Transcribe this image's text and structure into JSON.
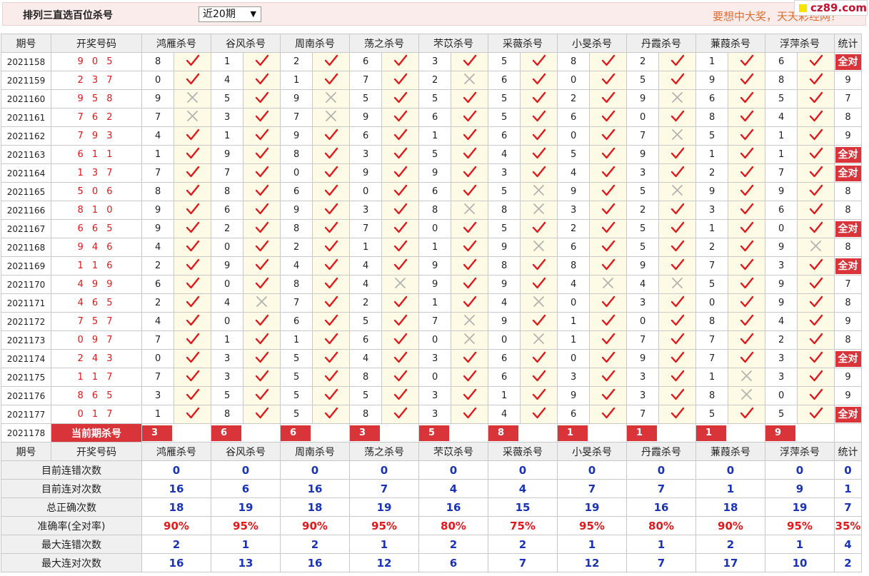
{
  "header": {
    "title": "排列三直选百位杀号",
    "period_select": "近20期",
    "slogan": "要想中大奖，天天彩经网！",
    "logo_text": "cz89.com"
  },
  "table": {
    "columns": {
      "period": "期号",
      "draw": "开奖号码",
      "experts": [
        "鸿雁杀号",
        "谷风杀号",
        "周南杀号",
        "荡之杀号",
        "芣苡杀号",
        "采薇杀号",
        "小旻杀号",
        "丹霞杀号",
        "蒹葭杀号",
        "浮萍杀号"
      ],
      "stat": "统计"
    },
    "rows": [
      {
        "period": "2021158",
        "draw": "9 0 5",
        "kills": [
          "8",
          "1",
          "2",
          "6",
          "3",
          "5",
          "8",
          "2",
          "1",
          "6"
        ],
        "results": [
          1,
          1,
          1,
          1,
          1,
          1,
          1,
          1,
          1,
          1
        ],
        "stat": "全对"
      },
      {
        "period": "2021159",
        "draw": "2 3 7",
        "kills": [
          "0",
          "4",
          "1",
          "7",
          "2",
          "6",
          "0",
          "5",
          "9",
          "8"
        ],
        "results": [
          1,
          1,
          1,
          1,
          0,
          1,
          1,
          1,
          1,
          1
        ],
        "stat": "9"
      },
      {
        "period": "2021160",
        "draw": "9 5 8",
        "kills": [
          "9",
          "5",
          "9",
          "5",
          "5",
          "5",
          "2",
          "9",
          "6",
          "5"
        ],
        "results": [
          0,
          1,
          0,
          1,
          1,
          1,
          1,
          0,
          1,
          1
        ],
        "stat": "7"
      },
      {
        "period": "2021161",
        "draw": "7 6 2",
        "kills": [
          "7",
          "3",
          "7",
          "9",
          "6",
          "5",
          "6",
          "0",
          "8",
          "4"
        ],
        "results": [
          0,
          1,
          0,
          1,
          1,
          1,
          1,
          1,
          1,
          1
        ],
        "stat": "8"
      },
      {
        "period": "2021162",
        "draw": "7 9 3",
        "kills": [
          "4",
          "1",
          "9",
          "6",
          "1",
          "6",
          "0",
          "7",
          "5",
          "1"
        ],
        "results": [
          1,
          1,
          1,
          1,
          1,
          1,
          1,
          0,
          1,
          1
        ],
        "stat": "9"
      },
      {
        "period": "2021163",
        "draw": "6 1 1",
        "kills": [
          "1",
          "9",
          "8",
          "3",
          "5",
          "4",
          "5",
          "9",
          "1",
          "1"
        ],
        "results": [
          1,
          1,
          1,
          1,
          1,
          1,
          1,
          1,
          1,
          1
        ],
        "stat": "全对"
      },
      {
        "period": "2021164",
        "draw": "1 3 7",
        "kills": [
          "7",
          "7",
          "0",
          "9",
          "9",
          "3",
          "4",
          "3",
          "2",
          "7"
        ],
        "results": [
          1,
          1,
          1,
          1,
          1,
          1,
          1,
          1,
          1,
          1
        ],
        "stat": "全对"
      },
      {
        "period": "2021165",
        "draw": "5 0 6",
        "kills": [
          "8",
          "8",
          "6",
          "0",
          "6",
          "5",
          "9",
          "5",
          "9",
          "9"
        ],
        "results": [
          1,
          1,
          1,
          1,
          1,
          0,
          1,
          0,
          1,
          1
        ],
        "stat": "8"
      },
      {
        "period": "2021166",
        "draw": "8 1 0",
        "kills": [
          "9",
          "6",
          "9",
          "3",
          "8",
          "8",
          "3",
          "2",
          "3",
          "6"
        ],
        "results": [
          1,
          1,
          1,
          1,
          0,
          0,
          1,
          1,
          1,
          1
        ],
        "stat": "8"
      },
      {
        "period": "2021167",
        "draw": "6 6 5",
        "kills": [
          "9",
          "2",
          "8",
          "7",
          "0",
          "5",
          "2",
          "5",
          "1",
          "0"
        ],
        "results": [
          1,
          1,
          1,
          1,
          1,
          1,
          1,
          1,
          1,
          1
        ],
        "stat": "全对"
      },
      {
        "period": "2021168",
        "draw": "9 4 6",
        "kills": [
          "4",
          "0",
          "2",
          "1",
          "1",
          "9",
          "6",
          "5",
          "2",
          "9"
        ],
        "results": [
          1,
          1,
          1,
          1,
          1,
          0,
          1,
          1,
          1,
          0
        ],
        "stat": "8"
      },
      {
        "period": "2021169",
        "draw": "1 1 6",
        "kills": [
          "2",
          "9",
          "4",
          "4",
          "9",
          "8",
          "8",
          "9",
          "7",
          "3"
        ],
        "results": [
          1,
          1,
          1,
          1,
          1,
          1,
          1,
          1,
          1,
          1
        ],
        "stat": "全对"
      },
      {
        "period": "2021170",
        "draw": "4 9 9",
        "kills": [
          "6",
          "0",
          "8",
          "4",
          "9",
          "9",
          "4",
          "4",
          "5",
          "9"
        ],
        "results": [
          1,
          1,
          1,
          0,
          1,
          1,
          0,
          0,
          1,
          1
        ],
        "stat": "7"
      },
      {
        "period": "2021171",
        "draw": "4 6 5",
        "kills": [
          "2",
          "4",
          "7",
          "2",
          "1",
          "4",
          "0",
          "3",
          "0",
          "9"
        ],
        "results": [
          1,
          0,
          1,
          1,
          1,
          0,
          1,
          1,
          1,
          1
        ],
        "stat": "8"
      },
      {
        "period": "2021172",
        "draw": "7 5 7",
        "kills": [
          "4",
          "0",
          "6",
          "5",
          "7",
          "9",
          "1",
          "0",
          "8",
          "4"
        ],
        "results": [
          1,
          1,
          1,
          1,
          0,
          1,
          1,
          1,
          1,
          1
        ],
        "stat": "9"
      },
      {
        "period": "2021173",
        "draw": "0 9 7",
        "kills": [
          "7",
          "1",
          "1",
          "6",
          "0",
          "0",
          "1",
          "7",
          "7",
          "2"
        ],
        "results": [
          1,
          1,
          1,
          1,
          0,
          0,
          1,
          1,
          1,
          1
        ],
        "stat": "8"
      },
      {
        "period": "2021174",
        "draw": "2 4 3",
        "kills": [
          "0",
          "3",
          "5",
          "4",
          "3",
          "6",
          "0",
          "9",
          "7",
          "3"
        ],
        "results": [
          1,
          1,
          1,
          1,
          1,
          1,
          1,
          1,
          1,
          1
        ],
        "stat": "全对"
      },
      {
        "period": "2021175",
        "draw": "1 1 7",
        "kills": [
          "7",
          "3",
          "5",
          "8",
          "0",
          "6",
          "3",
          "3",
          "1",
          "3"
        ],
        "results": [
          1,
          1,
          1,
          1,
          1,
          1,
          1,
          1,
          0,
          1
        ],
        "stat": "9"
      },
      {
        "period": "2021176",
        "draw": "8 6 5",
        "kills": [
          "3",
          "5",
          "5",
          "5",
          "3",
          "1",
          "9",
          "3",
          "8",
          "0"
        ],
        "results": [
          1,
          1,
          1,
          1,
          1,
          1,
          1,
          1,
          0,
          1
        ],
        "stat": "9"
      },
      {
        "period": "2021177",
        "draw": "0 1 7",
        "kills": [
          "1",
          "8",
          "5",
          "8",
          "3",
          "4",
          "6",
          "7",
          "5",
          "5"
        ],
        "results": [
          1,
          1,
          1,
          1,
          1,
          1,
          1,
          1,
          1,
          1
        ],
        "stat": "全对"
      }
    ],
    "current": {
      "period": "2021178",
      "label": "当前期杀号",
      "kills": [
        "3",
        "6",
        "6",
        "3",
        "5",
        "8",
        "1",
        "1",
        "1",
        "9"
      ]
    },
    "stats": [
      {
        "label": "目前连错次数",
        "values": [
          "0",
          "0",
          "0",
          "0",
          "0",
          "0",
          "0",
          "0",
          "0",
          "0"
        ],
        "total": "0"
      },
      {
        "label": "目前连对次数",
        "values": [
          "16",
          "6",
          "16",
          "7",
          "4",
          "4",
          "7",
          "7",
          "1",
          "9"
        ],
        "total": "1"
      },
      {
        "label": "总正确次数",
        "values": [
          "18",
          "19",
          "18",
          "19",
          "16",
          "15",
          "19",
          "16",
          "18",
          "19"
        ],
        "total": "7"
      },
      {
        "label": "准确率(全对率)",
        "values": [
          "90%",
          "95%",
          "90%",
          "95%",
          "80%",
          "75%",
          "95%",
          "80%",
          "90%",
          "95%"
        ],
        "total": "35%",
        "pct": true
      },
      {
        "label": "最大连错次数",
        "values": [
          "2",
          "1",
          "2",
          "1",
          "2",
          "2",
          "1",
          "1",
          "2",
          "1"
        ],
        "total": "4"
      },
      {
        "label": "最大连对次数",
        "values": [
          "16",
          "13",
          "16",
          "12",
          "6",
          "7",
          "12",
          "7",
          "17",
          "10"
        ],
        "total": "2"
      }
    ]
  },
  "icons": {
    "correct": "check-icon",
    "wrong": "cross-icon"
  },
  "colors": {
    "correct": "#e4171b",
    "wrong": "#b3b3b3",
    "accent": "#d9343a",
    "stat_value": "#1a33b8",
    "draw_number": "#e4171b"
  }
}
